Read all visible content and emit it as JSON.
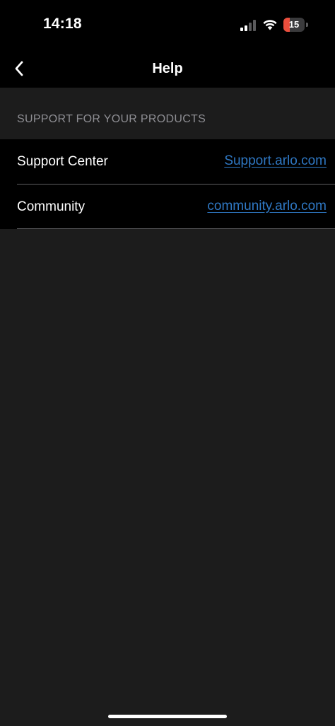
{
  "status_bar": {
    "time": "14:18",
    "battery_level": "15",
    "battery_fraction": 0.15,
    "battery_color": "#eb4e3d",
    "icons": [
      "signal-icon",
      "wifi-icon",
      "battery-icon"
    ]
  },
  "nav": {
    "title": "Help",
    "back_icon": "chevron-left-icon"
  },
  "section": {
    "header": "SUPPORT FOR YOUR PRODUCTS"
  },
  "rows": [
    {
      "label": "Support Center",
      "link": "Support.arlo.com"
    },
    {
      "label": "Community",
      "link": "community.arlo.com"
    }
  ],
  "colors": {
    "background": "#1c1c1c",
    "bar_background": "#000000",
    "link": "#2f78c4",
    "section_header_text": "#8e8e93"
  }
}
